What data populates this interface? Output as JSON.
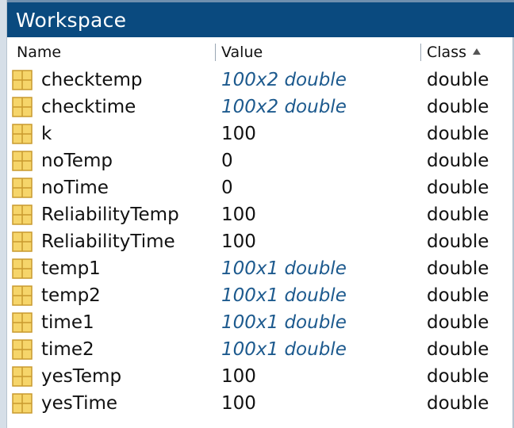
{
  "window": {
    "title": "Workspace"
  },
  "columns": {
    "name": "Name",
    "value": "Value",
    "class": "Class"
  },
  "rows": [
    {
      "name": "checktemp",
      "value": "100x2 double",
      "class": "double",
      "link": true
    },
    {
      "name": "checktime",
      "value": "100x2 double",
      "class": "double",
      "link": true
    },
    {
      "name": "k",
      "value": "100",
      "class": "double",
      "link": false
    },
    {
      "name": "noTemp",
      "value": "0",
      "class": "double",
      "link": false
    },
    {
      "name": "noTime",
      "value": "0",
      "class": "double",
      "link": false
    },
    {
      "name": "ReliabilityTemp",
      "value": "100",
      "class": "double",
      "link": false
    },
    {
      "name": "ReliabilityTime",
      "value": "100",
      "class": "double",
      "link": false
    },
    {
      "name": "temp1",
      "value": "100x1 double",
      "class": "double",
      "link": true
    },
    {
      "name": "temp2",
      "value": "100x1 double",
      "class": "double",
      "link": true
    },
    {
      "name": "time1",
      "value": "100x1 double",
      "class": "double",
      "link": true
    },
    {
      "name": "time2",
      "value": "100x1 double",
      "class": "double",
      "link": true
    },
    {
      "name": "yesTemp",
      "value": "100",
      "class": "double",
      "link": false
    },
    {
      "name": "yesTime",
      "value": "100",
      "class": "double",
      "link": false
    }
  ],
  "colors": {
    "title_bar": "#0a4a7f",
    "link_value": "#1d5a8e",
    "icon_fill": "#f6d56a",
    "icon_grid": "#c99a2e"
  },
  "icons": {
    "variable": "matrix-variable-icon",
    "sort": "sort-ascending-icon"
  }
}
